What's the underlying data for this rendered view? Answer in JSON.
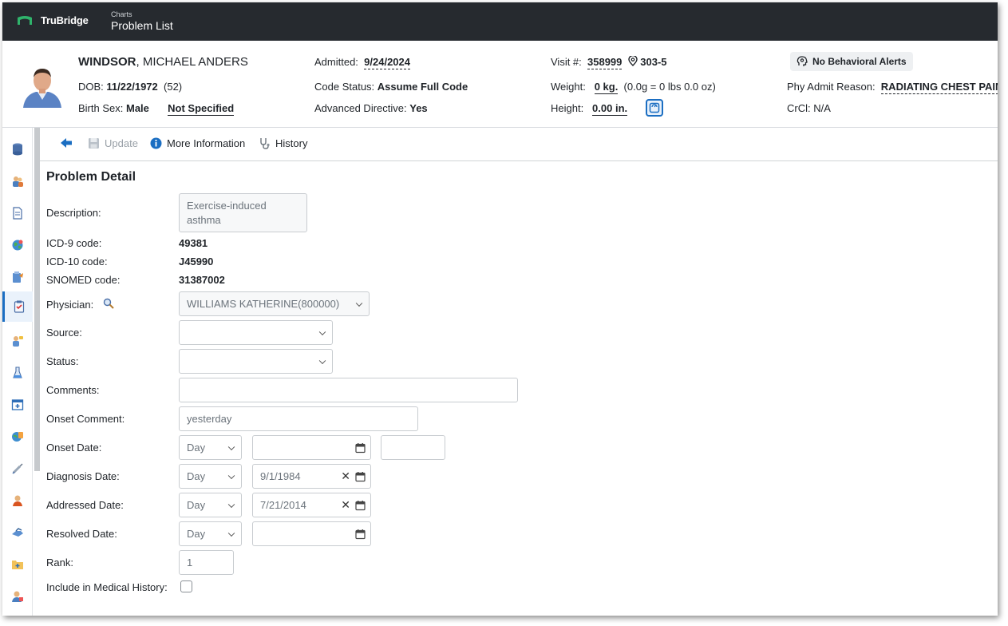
{
  "app": {
    "brand": "TruBridge",
    "section": "Charts",
    "page_title": "Problem List"
  },
  "patient": {
    "last_name": "WINDSOR",
    "first_names": "MICHAEL ANDERS",
    "dob_label": "DOB:",
    "dob": "11/22/1972",
    "age": "(52)",
    "birth_sex_label": "Birth Sex:",
    "birth_sex": "Male",
    "gender_identity": "Not Specified",
    "admitted_label": "Admitted:",
    "admitted": "9/24/2024",
    "code_status_label": "Code Status:",
    "code_status": "Assume Full Code",
    "adv_directive_label": "Advanced Directive:",
    "adv_directive": "Yes",
    "visit_label": "Visit #:",
    "visit": "358999",
    "room": "303-5",
    "weight_label": "Weight:",
    "weight": "0 kg.",
    "weight_detail": "(0.0g = 0 lbs 0.0 oz)",
    "height_label": "Height:",
    "height": "0.00 in.",
    "behavioral_alert": "No Behavioral Alerts",
    "admit_reason_label": "Phy Admit Reason:",
    "admit_reason": "RADIATING CHEST PAIN",
    "crcl_label": "CrCl:",
    "crcl": "N/A"
  },
  "toolbar": {
    "update": "Update",
    "more_info": "More Information",
    "history": "History"
  },
  "form": {
    "title": "Problem Detail",
    "description_label": "Description:",
    "description": "Exercise-induced asthma",
    "icd9_label": "ICD-9 code:",
    "icd9": "49381",
    "icd10_label": "ICD-10 code:",
    "icd10": "J45990",
    "snomed_label": "SNOMED code:",
    "snomed": "31387002",
    "physician_label": "Physician:",
    "physician": "WILLIAMS KATHERINE(800000)",
    "source_label": "Source:",
    "source": "",
    "status_label": "Status:",
    "status": "",
    "comments_label": "Comments:",
    "comments": "",
    "onset_comment_label": "Onset Comment:",
    "onset_comment": "yesterday",
    "onset_date_label": "Onset Date:",
    "onset_precision": "Day",
    "onset_date": "",
    "onset_extra": "",
    "diagnosis_date_label": "Diagnosis Date:",
    "diagnosis_precision": "Day",
    "diagnosis_date": "9/1/1984",
    "addressed_date_label": "Addressed Date:",
    "addressed_precision": "Day",
    "addressed_date": "7/21/2014",
    "resolved_date_label": "Resolved Date:",
    "resolved_precision": "Day",
    "resolved_date": "",
    "rank_label": "Rank:",
    "rank": "1",
    "include_history_label": "Include in Medical History:",
    "include_history": false
  },
  "colors": {
    "topbar": "#262a2f",
    "accent": "#1b6ec2",
    "brand_green": "#2fb36b"
  }
}
